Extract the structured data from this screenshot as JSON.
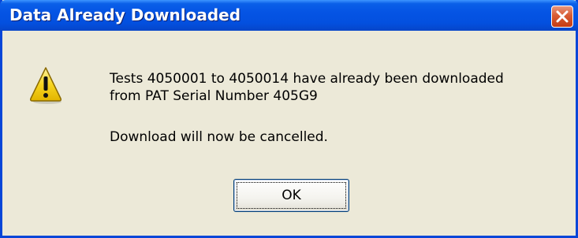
{
  "window": {
    "title": "Data Already Downloaded"
  },
  "titlebar": {
    "close_icon": "close-icon"
  },
  "content": {
    "icon": "warning-icon",
    "message_line_1": "Tests 4050001 to 4050014 have already been downloaded",
    "message_line_2": "from PAT Serial Number 405G9",
    "message_line_3": "Download will now be cancelled."
  },
  "buttons": {
    "ok_label": "OK"
  },
  "colors": {
    "titlebar_blue": "#0554e4",
    "close_red": "#d85c33",
    "dialog_face": "#ece9d8",
    "warning_yellow": "#f7d521"
  }
}
